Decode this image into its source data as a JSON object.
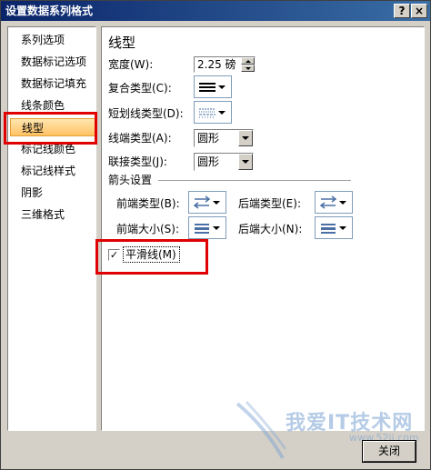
{
  "window": {
    "title": "设置数据系列格式",
    "help_btn": "?",
    "close_btn": "×"
  },
  "nav": {
    "items": [
      {
        "label": "系列选项"
      },
      {
        "label": "数据标记选项"
      },
      {
        "label": "数据标记填充"
      },
      {
        "label": "线条颜色"
      },
      {
        "label": "线型"
      },
      {
        "label": "标记线颜色"
      },
      {
        "label": "标记线样式"
      },
      {
        "label": "阴影"
      },
      {
        "label": "三维格式"
      }
    ],
    "selected": "线型"
  },
  "panel": {
    "title": "线型",
    "width": {
      "label": "宽度(W):",
      "value": "2.25 磅"
    },
    "compound": {
      "label": "复合类型(C):",
      "icon": "compound-lines-icon"
    },
    "dash": {
      "label": "短划线类型(D):",
      "icon": "dash-lines-icon"
    },
    "cap": {
      "label": "线端类型(A):",
      "value": "圆形"
    },
    "join": {
      "label": "联接类型(J):",
      "value": "圆形"
    },
    "arrow": {
      "section": "箭头设置",
      "begin_type": "前端类型(B):",
      "end_type": "后端类型(E):",
      "begin_size": "前端大小(S):",
      "end_size": "后端大小(N):"
    },
    "smooth": {
      "label": "平滑线(M)",
      "checked": true
    }
  },
  "footer": {
    "close_button": "关闭"
  },
  "watermark": {
    "text": "我爱IT技术网",
    "url": "www.52ij.com"
  },
  "colors": {
    "titlebar": "#0a246a",
    "highlight": "#e00000",
    "selected_item": "#ffc264"
  }
}
